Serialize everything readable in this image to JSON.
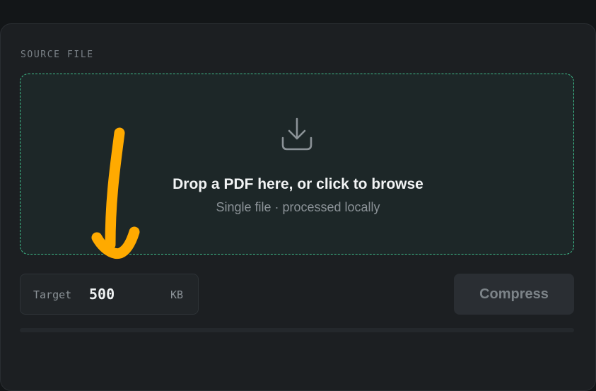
{
  "source_file": {
    "label": "SOURCE FILE"
  },
  "dropzone": {
    "icon": "download-icon",
    "title": "Drop a PDF here, or click to browse",
    "subtitle": "Single file · processed locally",
    "border_color": "#3fbf8c"
  },
  "target": {
    "label": "Target",
    "value": "500",
    "unit": "KB"
  },
  "compress_button": {
    "label": "Compress"
  },
  "progress": {
    "fraction": 0
  },
  "annotation": {
    "icon": "hand-drawn-down-arrow-icon",
    "color": "#ffaa00"
  }
}
